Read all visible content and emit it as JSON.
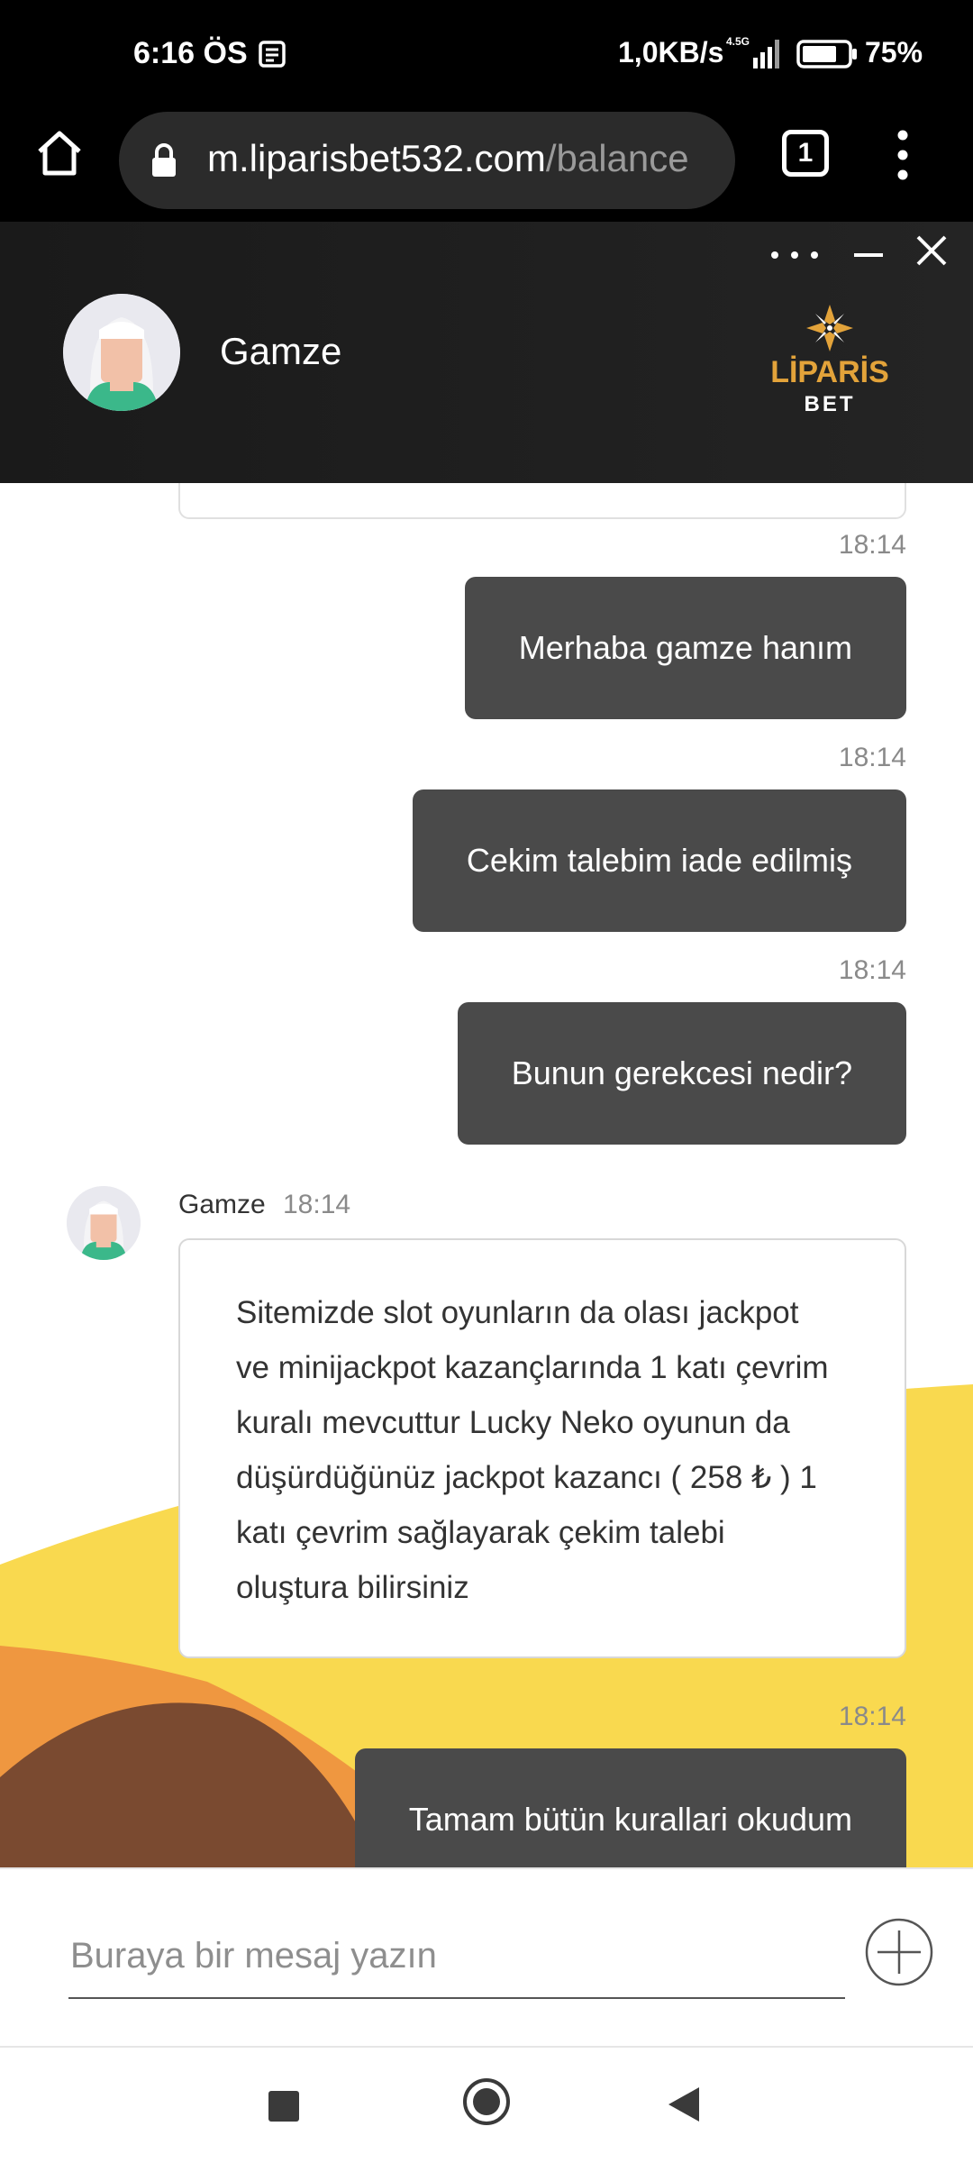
{
  "status_bar": {
    "time": "6:16 ÖS",
    "net_speed": "1,0KB/s",
    "net_type": "4.5G",
    "battery": "75%"
  },
  "browser": {
    "url_host": "m.liparisbet532.com",
    "url_path": "/balance",
    "tab_count": "1"
  },
  "chat_header": {
    "agent_name": "Gamze",
    "brand_top": "LİPARİS",
    "brand_bottom": "BET"
  },
  "messages": [
    {
      "direction": "out",
      "time": "18:14",
      "text": "Merhaba gamze hanım"
    },
    {
      "direction": "out",
      "time": "18:14",
      "text": "Cekim talebim iade edilmiş"
    },
    {
      "direction": "out",
      "time": "18:14",
      "text": "Bunun gerekcesi nedir?"
    },
    {
      "direction": "in",
      "sender": "Gamze",
      "time": "18:14",
      "lines": [
        "Sitemizde slot oyunların da olası jackpot",
        "ve minijackpot kazançlarında 1 katı çevrim",
        "kuralı mevcuttur Lucky Neko oyunun da",
        "düşürdüğünüz jackpot kazancı ( 258 ₺ ) 1",
        "katı çevrim sağlayarak çekim talebi",
        "oluştura bilirsiniz"
      ]
    },
    {
      "direction": "out",
      "time": "18:14",
      "text": "Tamam bütün kurallari okudum"
    }
  ],
  "input": {
    "placeholder": "Buraya bir mesaj yazın"
  },
  "colors": {
    "header_bg": "#1e1e1e",
    "outgoing_bubble": "#4a4a4a",
    "brand_gold": "#e3a33a",
    "wave_yellow": "#f9d94f",
    "wave_orange": "#ef9740",
    "wave_brown": "#7a4a30"
  },
  "icons": [
    "home-icon",
    "lock-icon",
    "tabs-icon",
    "more-vert-icon",
    "more-horiz-icon",
    "minimize-icon",
    "close-icon",
    "plus-circle-icon",
    "nav-recent-icon",
    "nav-home-icon",
    "nav-back-icon"
  ]
}
